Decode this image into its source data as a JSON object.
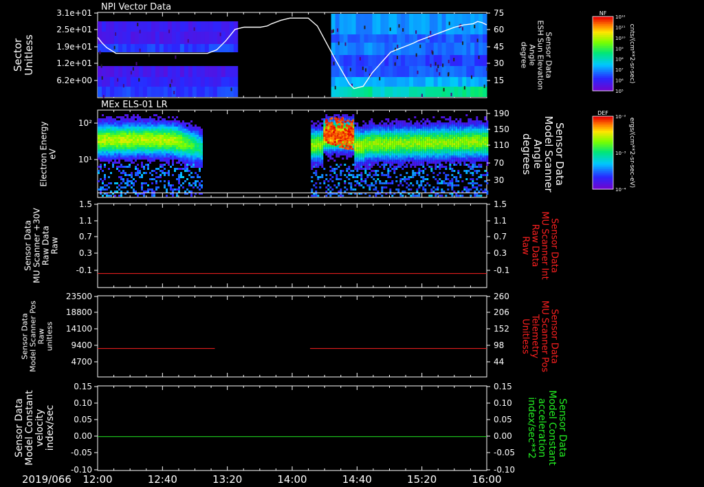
{
  "colors": {
    "background": "#000000",
    "axis": "#ffffff",
    "red_trace": "#ff2020",
    "green_trace": "#22ee22",
    "white_trace": "#ffffff"
  },
  "chart_data": [
    {
      "type": "heatmap",
      "title": "NPI Vector Data",
      "ylabel_lines": [
        "Sector",
        "Unitless"
      ],
      "y_ticks": [
        "3.1e+01",
        "2.5e+01",
        "1.9e+01",
        "1.2e+01",
        "6.2e+00"
      ],
      "y2label_lines": [
        "Sensor Data",
        "ESH Sun Elevation",
        "Angle",
        "degree"
      ],
      "y2_ticks": [
        "75",
        "60",
        "45",
        "30",
        "15"
      ],
      "y2lim": [
        0,
        75
      ],
      "colorbar": {
        "title": "NF",
        "label": "cnts/(cm**2-sr-sec)",
        "ticks": [
          "10¹²",
          "10¹¹",
          "10¹⁰",
          "10⁹",
          "10⁸",
          "10⁷",
          "10⁶",
          "10⁵"
        ]
      },
      "overlay_series": {
        "name": "ESH Sun Elevation",
        "times_min": [
          0,
          5,
          10,
          20,
          40,
          60,
          80,
          100,
          110,
          120,
          130,
          140,
          150,
          160,
          170,
          178,
          185,
          190,
          200,
          210,
          220,
          230,
          240,
          260,
          275,
          280,
          290,
          300,
          320,
          345,
          350,
          360,
          370,
          380,
          390,
          400,
          410,
          415,
          420,
          425
        ],
        "values": [
          53,
          48,
          44,
          39,
          39,
          39,
          39,
          39,
          39,
          39,
          42,
          50,
          60,
          62,
          62,
          62,
          63,
          65,
          68,
          70,
          70,
          70,
          63,
          33,
          12,
          8,
          10,
          22,
          40,
          48,
          50,
          53,
          56,
          59,
          62,
          64,
          65,
          67,
          66,
          64
        ]
      }
    },
    {
      "type": "heatmap",
      "title": "MEx ELS-01 LR",
      "ylabel_lines": [
        "Electron Energy",
        "eV"
      ],
      "y_ticks": [
        "10²",
        "10¹"
      ],
      "y2label_lines": [
        "Sensor Data",
        "Model Scanner",
        "Angle",
        "degrees"
      ],
      "y2_ticks": [
        "190",
        "150",
        "110",
        "70",
        "30"
      ],
      "y2lim": [
        0,
        190
      ],
      "colorbar": {
        "title": "DEF",
        "label": "ergs/(cm**2-sr-sec-eV)",
        "ticks": [
          "10⁻²",
          "10⁻³",
          "10⁻⁴"
        ]
      },
      "overlay_series": {
        "name": "Model Scanner Angle",
        "times_min": [
          0,
          425
        ],
        "values": [
          10,
          10
        ]
      }
    },
    {
      "type": "line",
      "ylabel_lines": [
        "Sensor Data",
        "MU Scanner +30V",
        "Raw Data",
        "Raw"
      ],
      "y_ticks": [
        "1.5",
        "1.1",
        "0.7",
        "0.3",
        "-0.1"
      ],
      "ylim": [
        -0.3,
        1.5
      ],
      "y2label_lines": [
        "Sensor Data",
        "MU Scanner Int",
        "Raw Data",
        "Raw"
      ],
      "y2_ticks": [
        "1.5",
        "1.1",
        "0.7",
        "0.3",
        "-0.1"
      ],
      "y2lim": [
        -0.3,
        1.5
      ],
      "series": [
        {
          "name": "MU Scanner +30V",
          "segments": [
            [
              0,
              425
            ]
          ],
          "value": 0.0
        }
      ]
    },
    {
      "type": "line",
      "ylabel_lines": [
        "Sensor Data",
        "Model Scanner Pos",
        "Raw",
        "unitless"
      ],
      "y_ticks": [
        "23500",
        "18800",
        "14100",
        "9400",
        "4700"
      ],
      "ylim": [
        0,
        23500
      ],
      "y2label_lines": [
        "Sensor Data",
        "MU Scanner Pos",
        "Telemetry",
        "Unitless"
      ],
      "y2_ticks": [
        "260",
        "206",
        "152",
        "98",
        "44"
      ],
      "y2lim": [
        0,
        260
      ],
      "series": [
        {
          "name": "Model Scanner Pos",
          "segments": [
            [
              0,
              128
            ],
            [
              232,
              425
            ]
          ],
          "value": 8250
        }
      ]
    },
    {
      "type": "line",
      "ylabel_lines": [
        "Sensor Data",
        "Model Constant",
        "velocity",
        "index/sec"
      ],
      "y_ticks": [
        "0.15",
        "0.10",
        "0.05",
        "0.00",
        "-0.05",
        "-0.10"
      ],
      "ylim": [
        -0.1,
        0.15
      ],
      "y2label_lines": [
        "Sensor Data",
        "Model Constant",
        "acceleration",
        "index/sec**2"
      ],
      "y2_ticks": [
        "0.15",
        "0.10",
        "0.05",
        "0.00",
        "-0.05",
        "-0.10"
      ],
      "y2lim": [
        -0.1,
        0.15
      ],
      "series": [
        {
          "name": "Model Constant velocity",
          "segments": [
            [
              0,
              425
            ]
          ],
          "value": 0.0
        }
      ]
    }
  ],
  "x_axis": {
    "date_label": "2019/066",
    "tick_labels": [
      "12:00",
      "12:40",
      "13:20",
      "14:00",
      "14:40",
      "15:20",
      "16:00"
    ],
    "range_min": [
      0,
      240
    ]
  }
}
